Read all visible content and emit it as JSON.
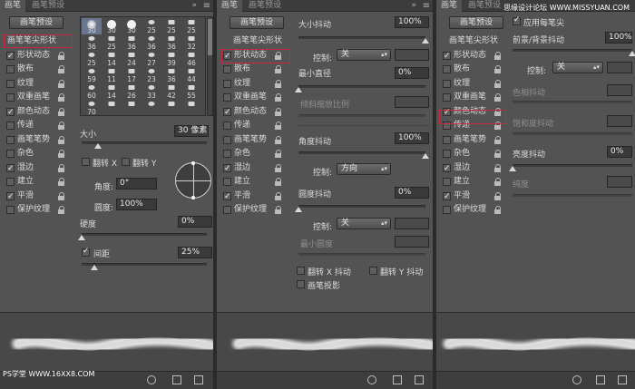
{
  "panel1": {
    "tabs": [
      "画笔",
      "画笔预设"
    ],
    "collapse_icon": "»",
    "menu_icon": "≡",
    "preset_button": "画笔预设",
    "sidebar_header": "画笔笔尖形状",
    "sidebar_items": [
      {
        "label": "形状动态",
        "checked": true
      },
      {
        "label": "散布",
        "checked": false
      },
      {
        "label": "纹理",
        "checked": false
      },
      {
        "label": "双重画笔",
        "checked": false
      },
      {
        "label": "颜色动态",
        "checked": true
      },
      {
        "label": "传递",
        "checked": false
      },
      {
        "label": "画笔笔势",
        "checked": false
      },
      {
        "label": "杂色",
        "checked": false
      },
      {
        "label": "湿边",
        "checked": true
      },
      {
        "label": "建立",
        "checked": false
      },
      {
        "label": "平滑",
        "checked": true
      },
      {
        "label": "保护纹理",
        "checked": false
      }
    ],
    "brush_sizes": [
      "30",
      "30",
      "30",
      "25",
      "25",
      "25",
      "36",
      "25",
      "36",
      "36",
      "36",
      "32",
      "25",
      "14",
      "24",
      "27",
      "39",
      "46",
      "59",
      "11",
      "17",
      "23",
      "36",
      "44",
      "60",
      "14",
      "26",
      "33",
      "42",
      "55",
      "70",
      "",
      "",
      "",
      "",
      "",
      ""
    ],
    "size_label": "大小",
    "size_value": "30 像素",
    "flip_x_label": "翻转 X",
    "flip_y_label": "翻转 Y",
    "angle_label": "角度:",
    "angle_value": "0°",
    "roundness_label": "圆度:",
    "roundness_value": "100%",
    "hardness_label": "硬度",
    "hardness_value": "0%",
    "spacing_label": "间距",
    "spacing_value": "25%",
    "spacing_checked": true
  },
  "panel2": {
    "tabs": [
      "画笔",
      "画笔预设"
    ],
    "collapse_icon": "»",
    "menu_icon": "≡",
    "preset_button": "画笔预设",
    "sidebar_header": "画笔笔尖形状",
    "sidebar_items": [
      {
        "label": "形状动态",
        "checked": true
      },
      {
        "label": "散布",
        "checked": false
      },
      {
        "label": "纹理",
        "checked": false
      },
      {
        "label": "双重画笔",
        "checked": false
      },
      {
        "label": "颜色动态",
        "checked": true
      },
      {
        "label": "传递",
        "checked": false
      },
      {
        "label": "画笔笔势",
        "checked": false
      },
      {
        "label": "杂色",
        "checked": false
      },
      {
        "label": "湿边",
        "checked": true
      },
      {
        "label": "建立",
        "checked": false
      },
      {
        "label": "平滑",
        "checked": true
      },
      {
        "label": "保护纹理",
        "checked": false
      }
    ],
    "size_jitter_label": "大小抖动",
    "size_jitter_value": "100%",
    "control_label": "控制:",
    "control1_value": "关",
    "min_diameter_label": "最小直径",
    "min_diameter_value": "0%",
    "tilt_scale_label": "倾斜缩放比例",
    "angle_jitter_label": "角度抖动",
    "angle_jitter_value": "100%",
    "control2_value": "方向",
    "roundness_jitter_label": "圆度抖动",
    "roundness_jitter_value": "0%",
    "control3_value": "关",
    "min_roundness_label": "最小圆度",
    "flip_x_jitter": "翻转 X 抖动",
    "flip_y_jitter": "翻转 Y 抖动",
    "brush_projection": "画笔投影"
  },
  "panel3": {
    "tabs": [
      "画笔",
      "画笔预设"
    ],
    "collapse_icon": "»",
    "menu_icon": "≡",
    "watermark": "思缘设计论坛 WWW.MISSYUAN.COM",
    "preset_button": "画笔预设",
    "sidebar_header": "画笔笔尖形状",
    "sidebar_items": [
      {
        "label": "形状动态",
        "checked": true
      },
      {
        "label": "散布",
        "checked": false
      },
      {
        "label": "纹理",
        "checked": false
      },
      {
        "label": "双重画笔",
        "checked": false
      },
      {
        "label": "颜色动态",
        "checked": true
      },
      {
        "label": "传递",
        "checked": false
      },
      {
        "label": "画笔笔势",
        "checked": false
      },
      {
        "label": "杂色",
        "checked": false
      },
      {
        "label": "湿边",
        "checked": true
      },
      {
        "label": "建立",
        "checked": false
      },
      {
        "label": "平滑",
        "checked": true
      },
      {
        "label": "保护纹理",
        "checked": false
      }
    ],
    "apply_per_tip": "应用每笔尖",
    "fg_bg_jitter_label": "前景/背景抖动",
    "fg_bg_jitter_value": "100%",
    "control_label": "控制:",
    "control_value": "关",
    "hue_jitter_label": "色相抖动",
    "saturation_jitter_label": "饱和度抖动",
    "brightness_jitter_label": "亮度抖动",
    "brightness_jitter_value": "0%",
    "purity_label": "纯度"
  },
  "watermark_bottom": "PS学堂 WWW.16XX8.COM"
}
